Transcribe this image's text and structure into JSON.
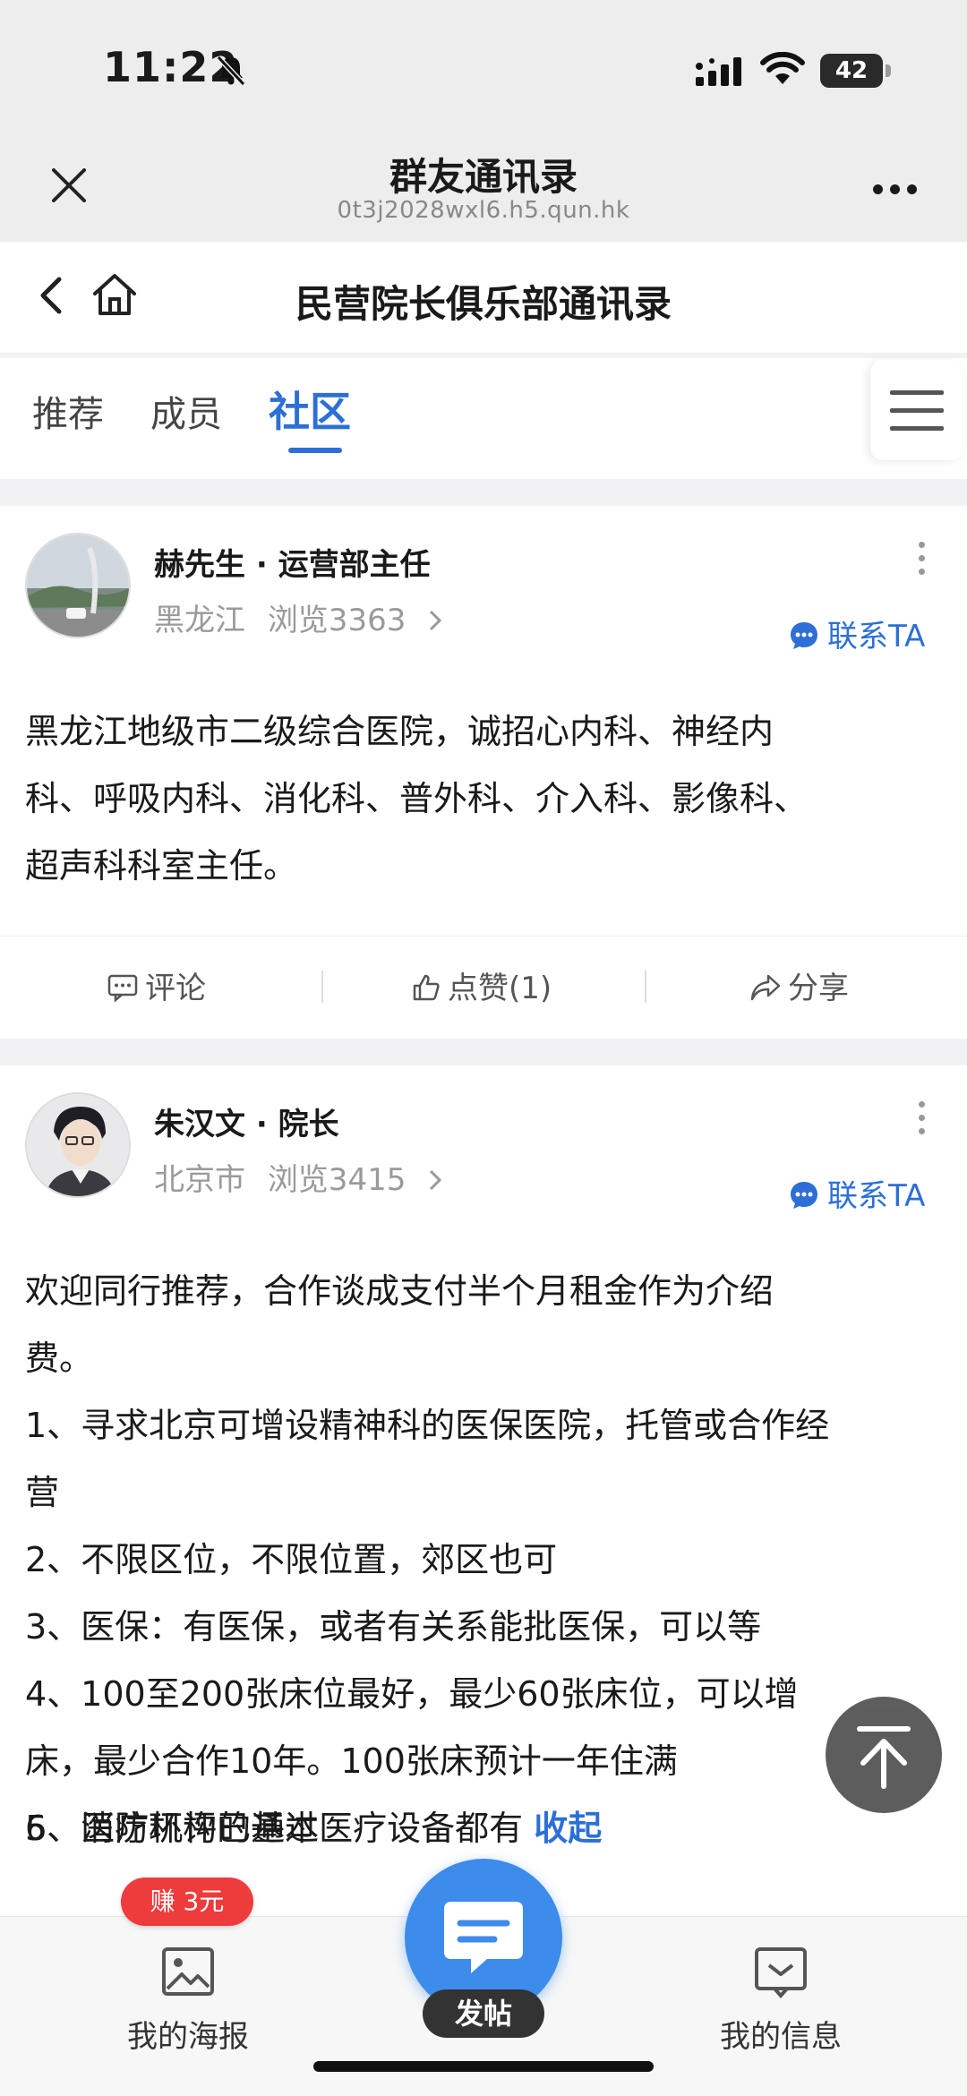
{
  "status_bar": {
    "time": "11:22",
    "battery": "42"
  },
  "title_bar": {
    "title": "群友通讯录",
    "url": "0t3j2028wxl6.h5.qun.hk"
  },
  "sub_header": {
    "title": "民营院长俱乐部通讯录"
  },
  "tabs": [
    {
      "label": "推荐",
      "active": false
    },
    {
      "label": "成员",
      "active": false
    },
    {
      "label": "社区",
      "active": true
    }
  ],
  "posts": [
    {
      "author": "赫先生 · 运营部主任",
      "location": "黑龙江",
      "views": "浏览3363",
      "contact_label": "联系TA",
      "body": "黑龙江地级市二级综合医院，诚招心内科、神经内\n科、呼吸内科、消化科、普外科、介入科、影像科、\n超声科科室主任。",
      "actions": {
        "comment": "评论",
        "like": "点赞(1)",
        "share": "分享"
      }
    },
    {
      "author": "朱汉文 · 院长",
      "location": "北京市",
      "views": "浏览3415",
      "contact_label": "联系TA",
      "body": "欢迎同行推荐，合作谈成支付半个月租金作为介绍\n费。\n1、寻求北京可增设精神科的医保医院，托管或合作经\n营\n2、不限区位，不限位置，郊区也可\n3、医保：有医保，或者有关系能批医保，可以等\n4、100至200张床位最好，最少60张床位，可以增\n床，最少合作10年。100张床预计一年住满\n5、消防环评已通过",
      "last_line": "6、医疗机构的基本医疗设备都有",
      "collapse_label": "收起"
    }
  ],
  "bottom_bar": {
    "my_poster": "我的海报",
    "earn_badge": "赚 3元",
    "post_button": "发帖",
    "my_info": "我的信息"
  },
  "colors": {
    "accent": "#2d6fd6",
    "fab": "#3d8bea",
    "badge": "#ee3b3b"
  }
}
